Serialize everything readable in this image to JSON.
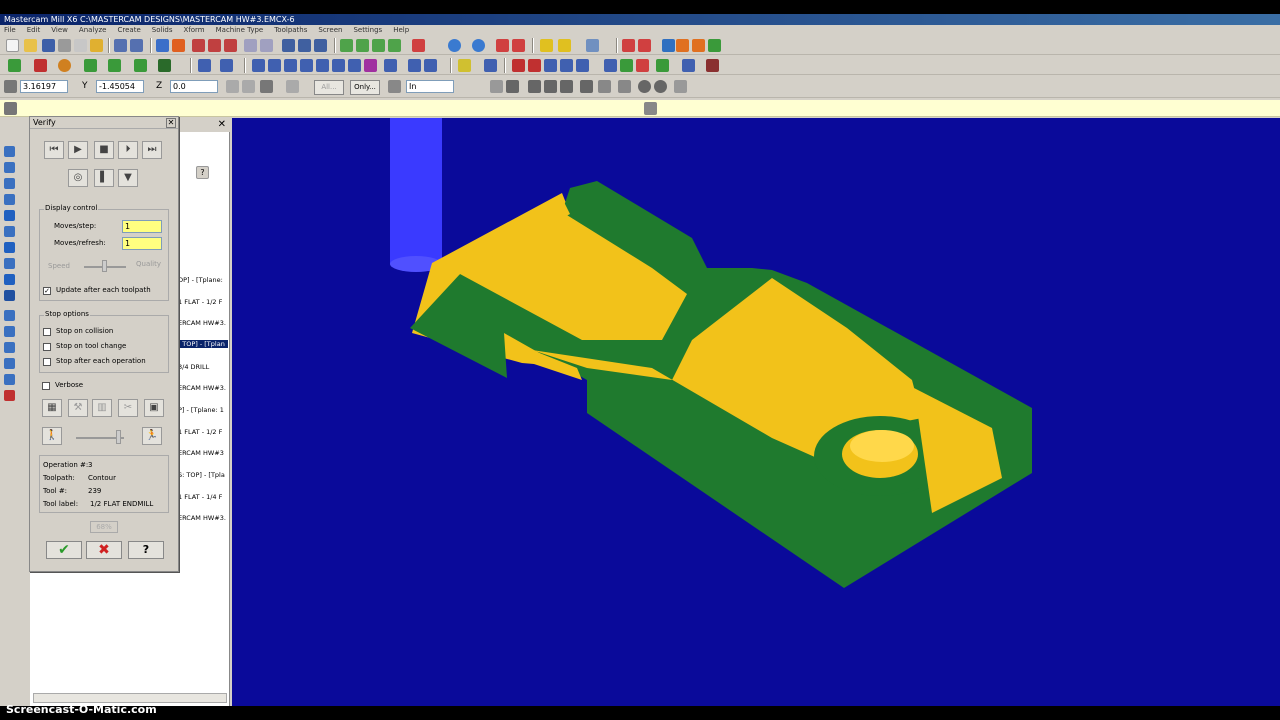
{
  "window": {
    "title": "Mastercam Mill X6  C:\\MASTERCAM DESIGNS\\MASTERCAM HW#3.EMCX-6"
  },
  "menu": [
    "File",
    "Edit",
    "View",
    "Analyze",
    "Create",
    "Solids",
    "Xform",
    "Machine Type",
    "Toolpaths",
    "Screen",
    "Settings",
    "Help"
  ],
  "coords": {
    "x_value": "3.16197",
    "y_label": "Y",
    "y_value": "-1.45054",
    "z_label": "Z",
    "z_value": "0.0",
    "units": "In",
    "all_label": "All...",
    "only_label": "Only..."
  },
  "manager": {
    "lines": [
      "OP] - [Tplane:",
      "1 FLAT - 1/2 F",
      "ERCAM HW#3.",
      ": TOP] - [Tplan",
      "3/4 DRILL",
      "ERCAM HW#3.",
      "P] - [Tplane: 1",
      "1 FLAT - 1/2 F",
      "ERCAM HW#3",
      "S: TOP] - [Tpla",
      "1 FLAT - 1/4 F",
      "ERCAM HW#3."
    ]
  },
  "verify": {
    "title": "Verify",
    "display_control": {
      "title": "Display control",
      "moves_step_label": "Moves/step:",
      "moves_step_value": "1",
      "moves_refresh_label": "Moves/refresh:",
      "moves_refresh_value": "1",
      "speed_label": "Speed",
      "quality_label": "Quality",
      "update_label": "Update after each toolpath",
      "update_checked": "✓"
    },
    "stop_options": {
      "title": "Stop options",
      "collision_label": "Stop on collision",
      "tool_change_label": "Stop on tool change",
      "after_op_label": "Stop after each operation"
    },
    "verbose_label": "Verbose",
    "info": {
      "operation_label": "Operation #:",
      "operation_value": "3",
      "toolpath_label": "Toolpath:",
      "toolpath_value": "Contour",
      "tool_label": "Tool #:",
      "tool_value": "239",
      "tool_label_label": "Tool label:",
      "tool_label_value": "1/2 FLAT ENDMILL"
    },
    "progress": "68%",
    "ok": "✔",
    "cancel": "✖",
    "help": "?"
  },
  "watermark": "Screencast-O-Matic.com",
  "colors": {
    "viewport_bg": "#0a0a9a",
    "part_top": "#1f7a2e",
    "part_wall": "#f2c21a",
    "tool": "#3a3aff"
  }
}
